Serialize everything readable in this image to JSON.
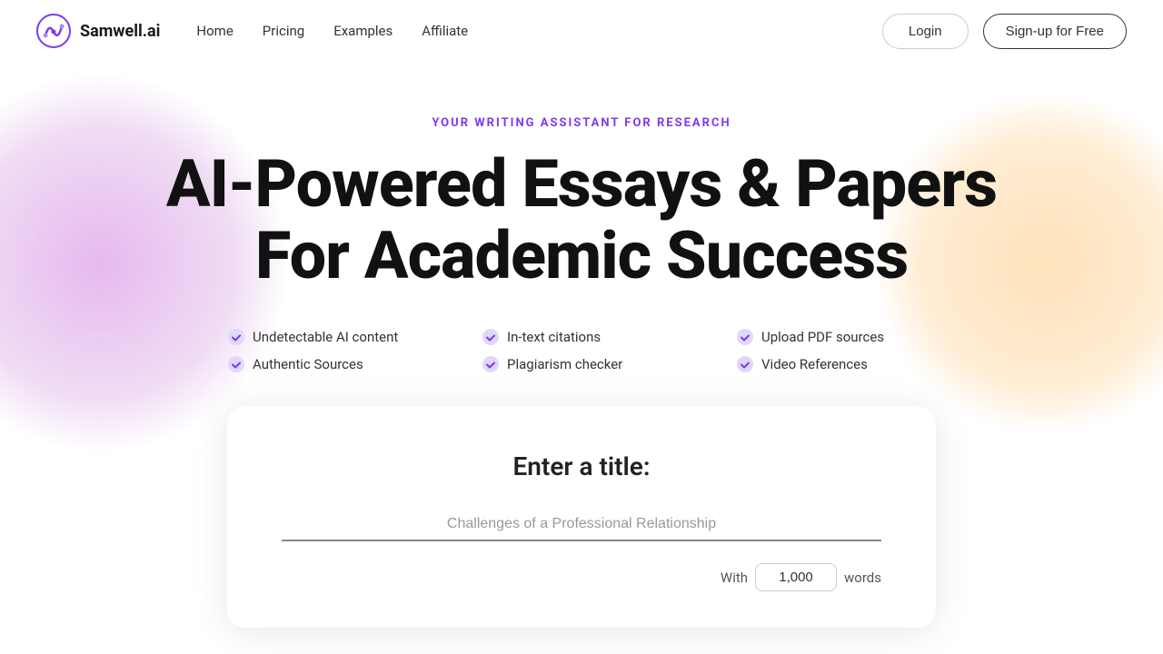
{
  "logo": {
    "text": "Samwell.ai"
  },
  "nav": {
    "links": [
      {
        "label": "Home",
        "id": "home"
      },
      {
        "label": "Pricing",
        "id": "pricing"
      },
      {
        "label": "Examples",
        "id": "examples"
      },
      {
        "label": "Affiliate",
        "id": "affiliate"
      }
    ],
    "login_label": "Login",
    "signup_label": "Sign-up for Free"
  },
  "hero": {
    "subtitle": "YOUR WRITING ASSISTANT FOR RESEARCH",
    "title_line1": "AI-Powered Essays & Papers",
    "title_line2": "For Academic Success",
    "features": [
      {
        "label": "Undetectable AI content"
      },
      {
        "label": "In-text citations"
      },
      {
        "label": "Upload PDF sources"
      },
      {
        "label": "Authentic Sources"
      },
      {
        "label": "Plagiarism checker"
      },
      {
        "label": "Video References"
      }
    ]
  },
  "input_card": {
    "title": "Enter a title:",
    "placeholder": "Challenges of a Professional Relationship",
    "words_prefix": "With",
    "words_value": "1,000",
    "words_suffix": "words"
  },
  "colors": {
    "purple": "#7c3aed",
    "accent": "#8b5cf6"
  }
}
